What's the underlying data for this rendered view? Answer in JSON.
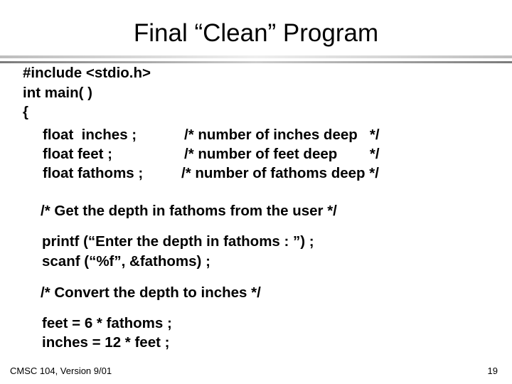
{
  "slide": {
    "title": "Final “Clean” Program",
    "code": {
      "include": "#include <stdio.h>",
      "main_decl": "int main( )",
      "open_brace": "{",
      "decls": [
        {
          "code": "float  inches ;",
          "comment": "/* number of inches deep   */"
        },
        {
          "code": "float feet ;",
          "comment": "/* number of feet deep        */"
        },
        {
          "code": "float fathoms ;",
          "comment": "/* number of fathoms deep */"
        }
      ],
      "comment_get": "/* Get the depth in fathoms from the user */",
      "printf_line": "printf (“Enter the depth in fathoms : ”) ;",
      "scanf_line": "scanf (“%f”, &fathoms) ;",
      "comment_convert": "/* Convert the depth to inches */",
      "feet_line": "feet = 6 * fathoms ;",
      "inches_line": "inches = 12 * feet ;"
    },
    "footer": {
      "course": "CMSC 104, Version 9/01",
      "page_number": "19"
    }
  }
}
